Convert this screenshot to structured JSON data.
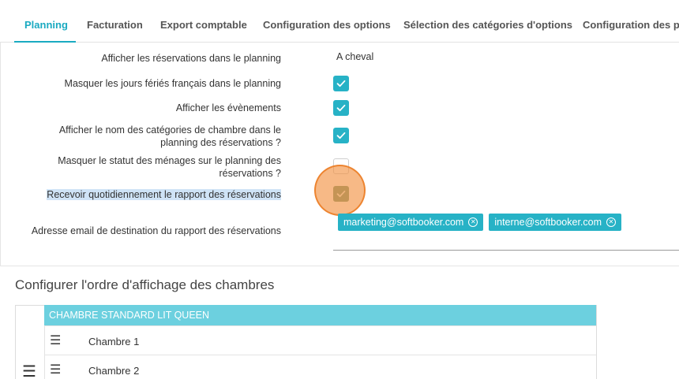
{
  "tabs": [
    {
      "label": "Planning",
      "active": true
    },
    {
      "label": "Facturation"
    },
    {
      "label": "Export comptable"
    },
    {
      "label": "Configuration des options"
    },
    {
      "label": "Sélection des catégories d'options"
    },
    {
      "label": "Configuration des pr"
    }
  ],
  "settings": {
    "display_reservations_label": "Afficher les réservations dans le planning",
    "display_reservations_value": "A cheval",
    "hide_holidays_label": "Masquer les jours fériés français dans le planning",
    "hide_holidays_checked": true,
    "show_events_label": "Afficher les évènements",
    "show_events_checked": true,
    "show_category_names_label_line1": "Afficher le nom des catégories de chambre dans le",
    "show_category_names_label_line2": "planning des réservations ?",
    "show_category_names_checked": true,
    "hide_housekeeping_label_line1": "Masquer le statut des ménages sur le planning des",
    "hide_housekeeping_label_line2": "réservations ?",
    "hide_housekeeping_checked": false,
    "daily_report_label": "Recevoir quotidiennement le rapport des réservations",
    "daily_report_checked": true,
    "report_email_label": "Adresse email de destination du rapport des réservations",
    "report_emails": [
      "marketing@softbooker.com",
      "interne@softbooker.com"
    ]
  },
  "room_order": {
    "title": "Configurer l'ordre d'affichage des chambres",
    "category": "CHAMBRE STANDARD LIT QUEEN",
    "rooms": [
      "Chambre 1",
      "Chambre 2"
    ]
  },
  "colors": {
    "accent": "#1aaac1",
    "checkbox": "#27b2c6",
    "category_header": "#6cd0df",
    "click_indicator": "#f28e3c"
  },
  "icons": {
    "check": "check-icon",
    "chip_remove": "circle-x-icon",
    "drag": "drag-handle-icon"
  }
}
